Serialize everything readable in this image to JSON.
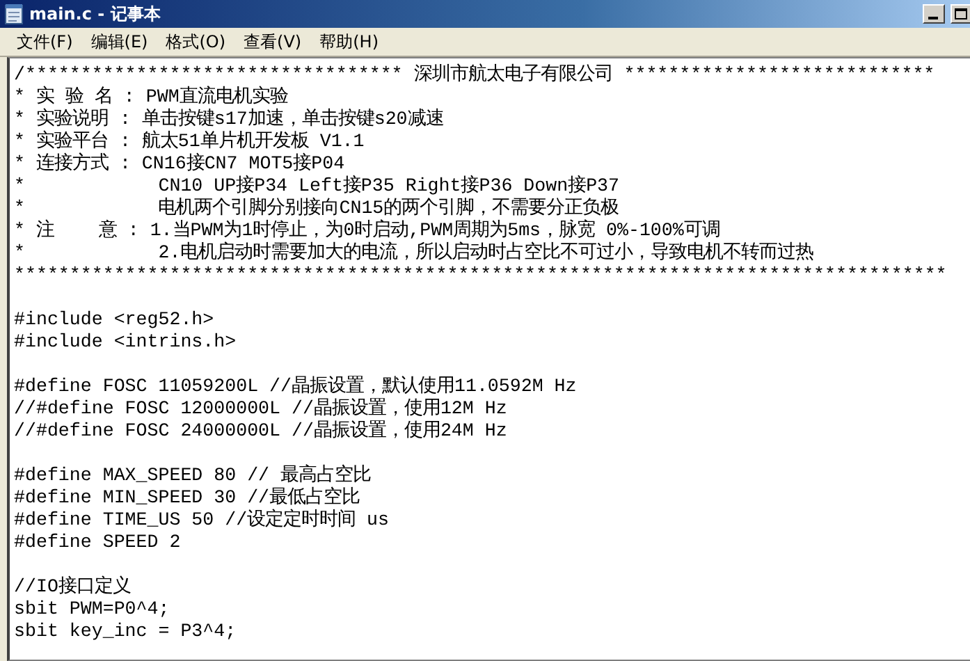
{
  "window": {
    "title": "main.c - 记事本"
  },
  "menu": [
    "文件(F)",
    "编辑(E)",
    "格式(O)",
    "查看(V)",
    "帮助(H)"
  ],
  "editor": {
    "blocks": [
      [
        "/********************************** 深圳市航太电子有限公司 ****************************",
        "* 实 验 名 : PWM直流电机实验",
        "* 实验说明 : 单击按键s17加速，单击按键s20减速",
        "* 实验平台 : 航太51单片机开发板 V1.1",
        "* 连接方式 : CN16接CN7 MOT5接P04",
        "*            CN10 UP接P34 Left接P35 Right接P36 Down接P37",
        "*            电机两个引脚分别接向CN15的两个引脚，不需要分正负极",
        "* 注    意 : 1.当PWM为1时停止，为0时启动,PWM周期为5ms，脉宽 0%-100%可调",
        "*            2.电机启动时需要加大的电流，所以启动时占空比不可过小，导致电机不转而过热",
        "************************************************************************************"
      ],
      [
        "#include <reg52.h>",
        "#include <intrins.h>"
      ],
      [
        "#define FOSC 11059200L //晶振设置，默认使用11.0592M Hz",
        "//#define FOSC 12000000L //晶振设置，使用12M Hz",
        "//#define FOSC 24000000L //晶振设置，使用24M Hz"
      ],
      [
        "#define MAX_SPEED 80 // 最高占空比",
        "#define MIN_SPEED 30 //最低占空比",
        "#define TIME_US 50 //设定定时时间 us",
        "#define SPEED 2"
      ],
      [
        "//IO接口定义",
        "sbit PWM=P0^4;",
        "sbit key_inc = P3^4;"
      ]
    ]
  }
}
